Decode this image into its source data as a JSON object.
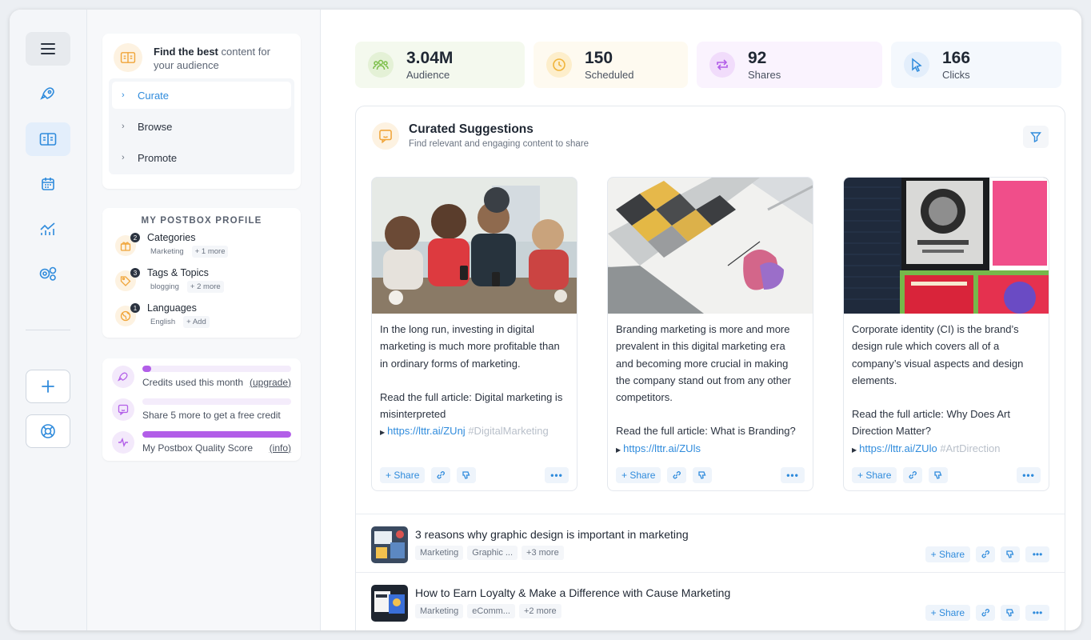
{
  "rail": {
    "items": [
      "menu-icon",
      "rocket-icon",
      "content-icon",
      "calendar-icon",
      "analytics-icon",
      "settings-icon",
      "plus-icon",
      "help-icon"
    ]
  },
  "find": {
    "title_bold": "Find the best",
    "title_rest": " content for your audience",
    "nav": [
      {
        "label": "Curate",
        "active": true
      },
      {
        "label": "Browse",
        "active": false
      },
      {
        "label": "Promote",
        "active": false
      }
    ]
  },
  "profile": {
    "title": "MY POSTBOX PROFILE",
    "rows": [
      {
        "count": "2",
        "name": "Categories",
        "tag": "Marketing",
        "more": "+ 1 more",
        "icon": "gift-icon"
      },
      {
        "count": "3",
        "name": "Tags & Topics",
        "tag": "blogging",
        "more": "+ 2 more",
        "icon": "tag-icon"
      },
      {
        "count": "1",
        "name": "Languages",
        "tag": "English",
        "more": "+ Add",
        "icon": "globe-icon"
      }
    ]
  },
  "meters": [
    {
      "label": "Credits used this month",
      "link": "(upgrade)",
      "fill": 0.06,
      "icon": "rocket-icon"
    },
    {
      "label": "Share 5 more to get a free credit",
      "link": "",
      "fill": 0.0,
      "icon": "chat-icon"
    },
    {
      "label": "My Postbox Quality Score",
      "link": "(info)",
      "fill": 1.0,
      "icon": "pulse-icon"
    }
  ],
  "stats": [
    {
      "value": "3.04M",
      "label": "Audience",
      "bg": "#f4f9ee",
      "icon_bg": "#e4f1d6",
      "color": "#7cbf4a",
      "icon": "people-icon"
    },
    {
      "value": "150",
      "label": "Scheduled",
      "bg": "#fefaf0",
      "icon_bg": "#fdeecb",
      "color": "#f0b43a",
      "icon": "clock-icon"
    },
    {
      "value": "92",
      "label": "Shares",
      "bg": "#faf3fe",
      "icon_bg": "#f1dcfb",
      "color": "#b25ee8",
      "icon": "repost-icon"
    },
    {
      "value": "166",
      "label": "Clicks",
      "bg": "#f4f8fd",
      "icon_bg": "#e3eefb",
      "color": "#2f8bdc",
      "icon": "cursor-icon"
    }
  ],
  "panel": {
    "title": "Curated Suggestions",
    "subtitle": "Find relevant and engaging content to share"
  },
  "cards": [
    {
      "body": "In the long run, investing in digital marketing is much more profitable than in ordinary forms of marketing.",
      "read": "Read the full article: Digital marketing is misinterpreted",
      "link": "https://lttr.ai/ZUnj",
      "hash": "#DigitalMarketing",
      "image": "people-with-phones-image"
    },
    {
      "body": "Branding marketing is more and more prevalent in this digital marketing era and becoming more crucial in making the company stand out from any other competitors.",
      "read": "Read the full article: What is Branding?",
      "link": "https://lttr.ai/ZUls",
      "hash": "",
      "image": "color-swatch-book-image"
    },
    {
      "body": "Corporate identity (CI) is the brand’s design rule which covers all of a company’s visual aspects and design elements.",
      "read": "Read the full article: Why Does Art Direction Matter?",
      "link": "https://lttr.ai/ZUlo",
      "hash": "#ArtDirection",
      "image": "posters-wall-image"
    }
  ],
  "actions": {
    "share": "+ Share",
    "more": "•••"
  },
  "list": [
    {
      "title": "3 reasons why graphic design is important in marketing",
      "tags": [
        "Marketing",
        "Graphic ...",
        "+3 more"
      ]
    },
    {
      "title": "How to Earn Loyalty & Make a Difference with Cause Marketing",
      "tags": [
        "Marketing",
        "eComm...",
        "+2 more"
      ]
    }
  ]
}
